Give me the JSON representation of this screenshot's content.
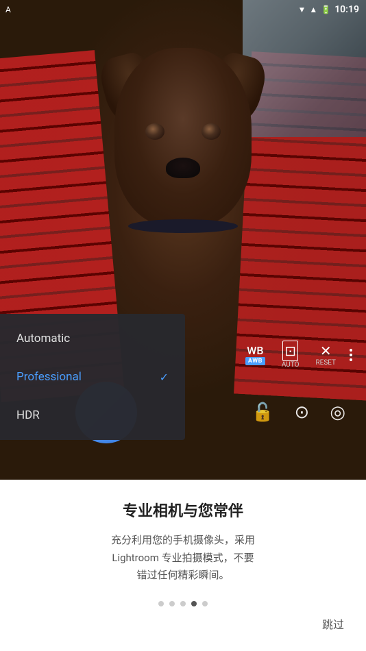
{
  "statusBar": {
    "time": "10:19"
  },
  "cameraUI": {
    "wbLabel": "WB",
    "wbBadge": "AWB",
    "autoLabel": "AUTO",
    "resetLabel": "RESET"
  },
  "dropdown": {
    "items": [
      {
        "id": "automatic",
        "label": "Automatic",
        "active": false
      },
      {
        "id": "professional",
        "label": "Professional",
        "active": true
      },
      {
        "id": "hdr",
        "label": "HDR",
        "active": false
      }
    ]
  },
  "bottomPanel": {
    "title": "专业相机与您常伴",
    "description": "充分利用您的手机摄像头，采用\nLightroom 专业拍摄模式，不要\n错过任何精彩瞬间。",
    "dots": [
      {
        "active": false
      },
      {
        "active": false
      },
      {
        "active": false
      },
      {
        "active": true
      },
      {
        "active": false
      }
    ],
    "skipLabel": "跳过"
  }
}
